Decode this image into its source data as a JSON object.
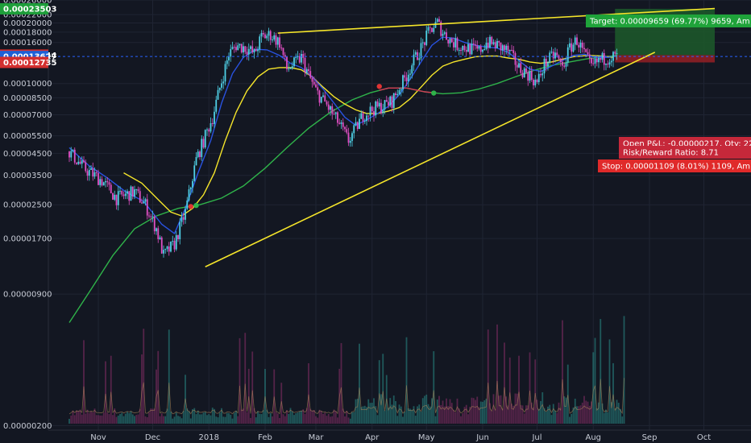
{
  "chart_data": {
    "type": "candlestick",
    "scale": "log",
    "ylim": [
      1.9e-06,
      0.00026
    ],
    "y_ticks": [
      "0.00026000",
      "0.00022000",
      "0.00020000",
      "0.00018000",
      "0.00016000",
      "0.00010000",
      "0.00008500",
      "0.00007000",
      "0.00005500",
      "0.00004500",
      "0.00003500",
      "0.00002500",
      "0.00001700",
      "0.00000900",
      "0.00000200"
    ],
    "y_tick_values": [
      0.00026,
      0.00022,
      0.0002,
      0.00018,
      0.00016,
      0.0001,
      8.5e-05,
      7e-05,
      5.5e-05,
      4.5e-05,
      3.5e-05,
      2.5e-05,
      1.7e-05,
      9e-06,
      2e-06
    ],
    "x_ticks": [
      {
        "label": "Nov",
        "day": 0
      },
      {
        "label": "Dec",
        "day": 30
      },
      {
        "label": "2018",
        "day": 61
      },
      {
        "label": "Feb",
        "day": 92
      },
      {
        "label": "Mar",
        "day": 120
      },
      {
        "label": "Apr",
        "day": 151
      },
      {
        "label": "May",
        "day": 181
      },
      {
        "label": "Jun",
        "day": 212
      },
      {
        "label": "Jul",
        "day": 242
      },
      {
        "label": "Aug",
        "day": 273
      },
      {
        "label": "Sep",
        "day": 304
      },
      {
        "label": "Oct",
        "day": 334
      }
    ],
    "price_labels": [
      {
        "text": "0.00023503",
        "value": 0.00023503,
        "color": "#1e9e3a"
      },
      {
        "text": "0.00013844",
        "value": 0.00013844,
        "color": "#d32f2f"
      },
      {
        "text": "0.00013627",
        "value": 0.00013627,
        "color": "#1e60d6"
      },
      {
        "text": "0.00012735",
        "value": 0.00012735,
        "color": "#d32f2f"
      }
    ],
    "current_price": 0.00013627,
    "position": {
      "start_day": 285,
      "end_day": 340,
      "target": 0.00023503,
      "entry": 0.00013844,
      "stop": 0.00012735,
      "target_text": "Target: 0.00009659 (69.77%) 9659, Am",
      "pnl_text": "Open P&L: -0.00000217, Qty: 22",
      "rr_text": "Risk/Reward Ratio: 8.71",
      "stop_text": "Stop: 0.00001109 (8.01%) 1109, Am"
    },
    "trendlines": [
      {
        "color": "#f5e52a",
        "points": [
          [
            99,
            0.000178
          ],
          [
            340,
            0.000236
          ]
        ]
      },
      {
        "color": "#f5e52a",
        "points": [
          [
            59,
            1.23e-05
          ],
          [
            307,
            0.000143
          ]
        ]
      }
    ],
    "close_path": [
      [
        -16,
        4.6e-05
      ],
      [
        -8,
        3.8e-05
      ],
      [
        2,
        3.3e-05
      ],
      [
        10,
        2.7e-05
      ],
      [
        20,
        2.9e-05
      ],
      [
        26,
        2.5e-05
      ],
      [
        32,
        1.9e-05
      ],
      [
        36,
        1.4e-05
      ],
      [
        42,
        1.6e-05
      ],
      [
        48,
        2.3e-05
      ],
      [
        54,
        4.2e-05
      ],
      [
        58,
        5.2e-05
      ],
      [
        63,
        6.8e-05
      ],
      [
        67,
        9.5e-05
      ],
      [
        72,
        0.00014
      ],
      [
        76,
        0.000155
      ],
      [
        82,
        0.00015
      ],
      [
        86,
        0.00014
      ],
      [
        90,
        0.00017
      ],
      [
        95,
        0.000175
      ],
      [
        100,
        0.00016
      ],
      [
        104,
        0.000118
      ],
      [
        108,
        0.000125
      ],
      [
        112,
        0.000135
      ],
      [
        116,
        0.00011
      ],
      [
        120,
        9.2e-05
      ],
      [
        126,
        7.8e-05
      ],
      [
        132,
        6.5e-05
      ],
      [
        138,
        5.2e-05
      ],
      [
        142,
        6e-05
      ],
      [
        146,
        7e-05
      ],
      [
        152,
        7.5e-05
      ],
      [
        158,
        7.8e-05
      ],
      [
        162,
        8.2e-05
      ],
      [
        166,
        9.5e-05
      ],
      [
        170,
        0.00011
      ],
      [
        174,
        0.00013
      ],
      [
        178,
        0.00015
      ],
      [
        183,
        0.000185
      ],
      [
        187,
        0.0002
      ],
      [
        190,
        0.00018
      ],
      [
        194,
        0.000165
      ],
      [
        198,
        0.000155
      ],
      [
        204,
        0.00015
      ],
      [
        210,
        0.000145
      ],
      [
        214,
        0.00016
      ],
      [
        220,
        0.000155
      ],
      [
        226,
        0.000145
      ],
      [
        232,
        0.00012
      ],
      [
        238,
        0.00011
      ],
      [
        242,
        0.0001
      ],
      [
        246,
        0.000125
      ],
      [
        252,
        0.00014
      ],
      [
        256,
        0.00012
      ],
      [
        260,
        0.00015
      ],
      [
        264,
        0.000165
      ],
      [
        268,
        0.00014
      ],
      [
        272,
        0.00012
      ],
      [
        276,
        0.00013
      ],
      [
        282,
        0.000136
      ]
    ],
    "ma_blue": [
      [
        -16,
        4.8e-05
      ],
      [
        -5,
        3.9e-05
      ],
      [
        5,
        3.4e-05
      ],
      [
        15,
        2.9e-05
      ],
      [
        25,
        2.6e-05
      ],
      [
        35,
        2e-05
      ],
      [
        42,
        1.8e-05
      ],
      [
        48,
        2.4e-05
      ],
      [
        55,
        3.6e-05
      ],
      [
        62,
        5.2e-05
      ],
      [
        68,
        8e-05
      ],
      [
        74,
        0.000112
      ],
      [
        80,
        0.000135
      ],
      [
        87,
        0.000148
      ],
      [
        93,
        0.000147
      ],
      [
        100,
        0.000138
      ],
      [
        106,
        0.000126
      ],
      [
        112,
        0.00012
      ],
      [
        118,
        0.000108
      ],
      [
        124,
        9.4e-05
      ],
      [
        130,
        8e-05
      ],
      [
        136,
        6.8e-05
      ],
      [
        142,
        6.2e-05
      ],
      [
        148,
        6.6e-05
      ],
      [
        154,
        7.1e-05
      ],
      [
        160,
        7.7e-05
      ],
      [
        166,
        8.8e-05
      ],
      [
        172,
        0.000105
      ],
      [
        178,
        0.000128
      ],
      [
        184,
        0.000155
      ],
      [
        190,
        0.00017
      ],
      [
        196,
        0.000168
      ],
      [
        202,
        0.00016
      ],
      [
        208,
        0.000155
      ],
      [
        214,
        0.000152
      ],
      [
        220,
        0.00015
      ],
      [
        226,
        0.000143
      ],
      [
        232,
        0.00013
      ],
      [
        238,
        0.000118
      ],
      [
        244,
        0.000115
      ],
      [
        250,
        0.000122
      ],
      [
        256,
        0.00013
      ],
      [
        262,
        0.000138
      ],
      [
        268,
        0.00014
      ],
      [
        274,
        0.000135
      ],
      [
        282,
        0.000135
      ]
    ],
    "ma_yellow": [
      [
        14,
        3.6e-05
      ],
      [
        24,
        3.2e-05
      ],
      [
        34,
        2.6e-05
      ],
      [
        40,
        2.3e-05
      ],
      [
        46,
        2.2e-05
      ],
      [
        52,
        2.4e-05
      ],
      [
        58,
        2.8e-05
      ],
      [
        64,
        3.6e-05
      ],
      [
        70,
        5.2e-05
      ],
      [
        76,
        7.2e-05
      ],
      [
        82,
        9.2e-05
      ],
      [
        88,
        0.000108
      ],
      [
        94,
        0.000118
      ],
      [
        100,
        0.00012
      ],
      [
        106,
        0.00012
      ],
      [
        112,
        0.000117
      ],
      [
        118,
        0.000108
      ],
      [
        124,
        9.6e-05
      ],
      [
        130,
        8.6e-05
      ],
      [
        136,
        7.9e-05
      ],
      [
        142,
        7.4e-05
      ],
      [
        148,
        7.1e-05
      ],
      [
        154,
        7.1e-05
      ],
      [
        160,
        7.3e-05
      ],
      [
        166,
        7.6e-05
      ],
      [
        172,
        8.4e-05
      ],
      [
        178,
        9.6e-05
      ],
      [
        184,
        0.00011
      ],
      [
        190,
        0.000122
      ],
      [
        196,
        0.000128
      ],
      [
        202,
        0.000132
      ],
      [
        208,
        0.000136
      ],
      [
        214,
        0.000137
      ],
      [
        220,
        0.000137
      ],
      [
        226,
        0.000134
      ],
      [
        232,
        0.000132
      ],
      [
        238,
        0.000128
      ],
      [
        244,
        0.000126
      ],
      [
        250,
        0.000128
      ],
      [
        256,
        0.000132
      ],
      [
        262,
        0.000136
      ],
      [
        270,
        0.000138
      ],
      [
        278,
        0.000137
      ],
      [
        284,
        0.000135
      ]
    ],
    "ma_green": [
      [
        -16,
        6.5e-06
      ],
      [
        -4,
        9.5e-06
      ],
      [
        8,
        1.4e-05
      ],
      [
        20,
        1.9e-05
      ],
      [
        32,
        2.2e-05
      ],
      [
        44,
        2.4e-05
      ],
      [
        56,
        2.5e-05
      ],
      [
        68,
        2.7e-05
      ],
      [
        80,
        3.1e-05
      ],
      [
        92,
        3.8e-05
      ],
      [
        104,
        4.8e-05
      ],
      [
        116,
        6e-05
      ],
      [
        128,
        7.2e-05
      ],
      [
        140,
        8.3e-05
      ],
      [
        150,
        9e-05
      ],
      [
        160,
        9.5e-05
      ],
      [
        170,
        9.5e-05
      ],
      [
        180,
        9.1e-05
      ],
      [
        190,
        8.9e-05
      ],
      [
        200,
        9e-05
      ],
      [
        210,
        9.4e-05
      ],
      [
        220,
        0.0001
      ],
      [
        230,
        0.000108
      ],
      [
        240,
        0.000116
      ],
      [
        250,
        0.000123
      ],
      [
        260,
        0.000128
      ],
      [
        270,
        0.000133
      ],
      [
        280,
        0.000136
      ],
      [
        286,
        0.000138
      ]
    ],
    "cross_markers": [
      {
        "day": 51,
        "value": 2.45e-05,
        "color": "#e03434"
      },
      {
        "day": 54,
        "value": 2.48e-05,
        "color": "#2fb34a"
      },
      {
        "day": 155,
        "value": 9.68e-05,
        "color": "#e03434"
      },
      {
        "day": 185,
        "value": 8.97e-05,
        "color": "#2fb34a"
      }
    ]
  }
}
